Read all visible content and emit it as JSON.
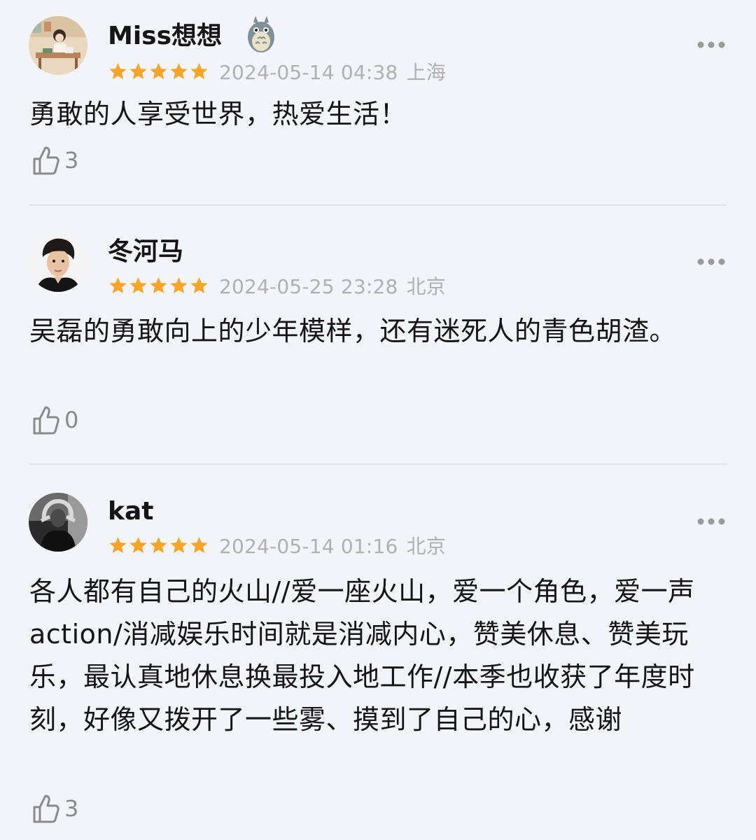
{
  "colors": {
    "background": "#f3f4f8",
    "star": "#f7a52a",
    "meta_text": "#b0b0b3",
    "divider": "#e2e3e7"
  },
  "comments": [
    {
      "username": "Miss想想",
      "has_badge": true,
      "badge_icon": "totoro-badge-icon",
      "rating": 5,
      "date": "2024-05-14 04:38",
      "location": "上海",
      "content": "勇敢的人享受世界，热爱生活！",
      "likes": "3"
    },
    {
      "username": "冬河马",
      "has_badge": false,
      "rating": 5,
      "date": "2024-05-25 23:28",
      "location": "北京",
      "content": "吴磊的勇敢向上的少年模样，还有迷死人的青色胡渣。",
      "likes": "0"
    },
    {
      "username": "kat",
      "has_badge": false,
      "rating": 5,
      "date": "2024-05-14 01:16",
      "location": "北京",
      "content": "各人都有自己的火山//爱一座火山，爱一个角色，爱一声 action/消减娱乐时间就是消减内心，赞美休息、赞美玩乐，最认真地休息换最投入地工作//本季也收获了年度时刻，好像又拨开了一些雾、摸到了自己的心，感谢",
      "likes": "3"
    }
  ]
}
